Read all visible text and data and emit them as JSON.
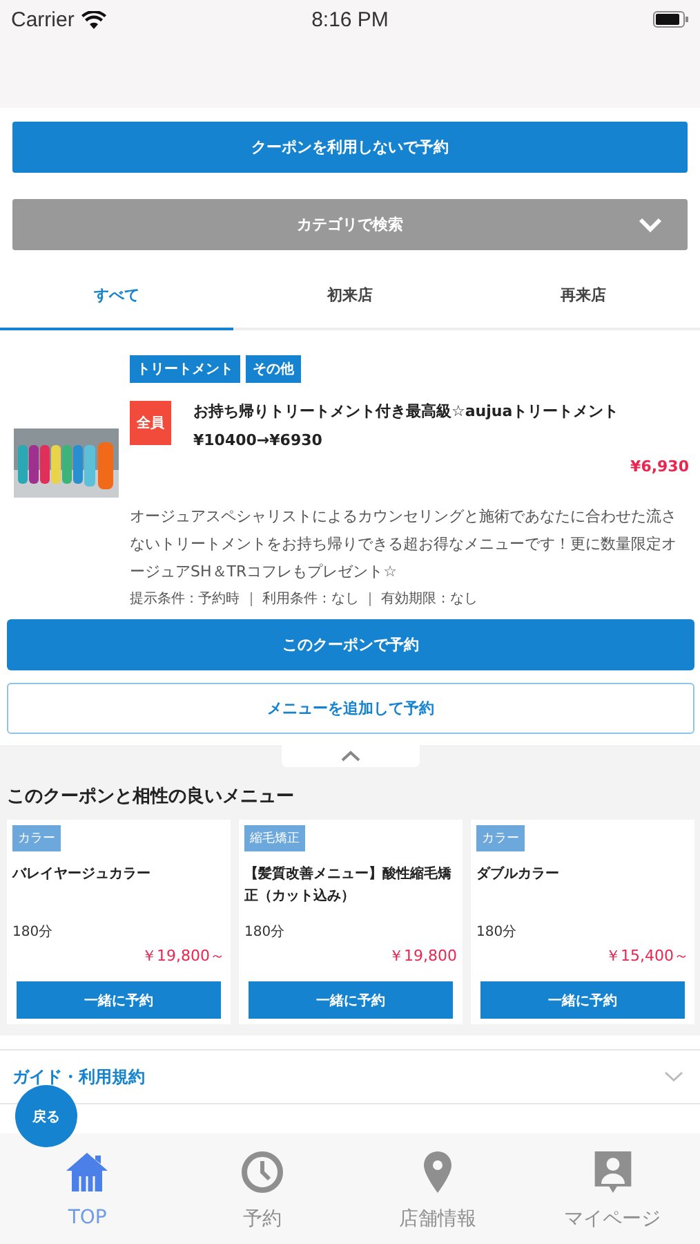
{
  "status_bar": {
    "carrier": "Carrier",
    "time": "8:16 PM"
  },
  "buttons": {
    "book_without_coupon": "クーポンを利用しないで予約",
    "category_search": "カテゴリで検索"
  },
  "tabs": [
    {
      "label": "すべて",
      "selected": true
    },
    {
      "label": "初来店",
      "selected": false
    },
    {
      "label": "再来店",
      "selected": false
    }
  ],
  "coupon": {
    "tags": [
      "トリートメント",
      "その他"
    ],
    "badge": "全員",
    "title": "お持ち帰りトリートメント付き最高級☆aujuaトリートメント¥10400→¥6930",
    "price": "¥6,930",
    "description": "オージュアスペシャリストによるカウンセリングと施術であなたに合わせた流さないトリートメントをお持ち帰りできる超お得なメニューです！更に数量限定オージュアSH＆TRコフレもプレゼント☆",
    "conditions": "提示条件 : 予約時 ｜ 利用条件 : なし ｜ 有効期限 : なし",
    "book_button": "このクーポンで予約",
    "add_menu_button": "メニューを追加して予約"
  },
  "recommended": {
    "title": "このクーポンと相性の良いメニュー",
    "menus": [
      {
        "tag": "カラー",
        "name": "バレイヤージュカラー",
        "duration": "180分",
        "price": "￥19,800～",
        "button": "一緒に予約"
      },
      {
        "tag": "縮毛矯正",
        "name": "【髪質改善メニュー】酸性縮毛矯正（カット込み）",
        "duration": "180分",
        "price": "￥19,800",
        "button": "一緒に予約"
      },
      {
        "tag": "カラー",
        "name": "ダブルカラー",
        "duration": "180分",
        "price": "￥15,400～",
        "button": "一緒に予約"
      }
    ]
  },
  "guide": "ガイド・利用規約",
  "back_button": "戻る",
  "bottom_nav": [
    {
      "label": "TOP",
      "selected": true
    },
    {
      "label": "予約",
      "selected": false
    },
    {
      "label": "店舗情報",
      "selected": false
    },
    {
      "label": "マイページ",
      "selected": false
    }
  ]
}
